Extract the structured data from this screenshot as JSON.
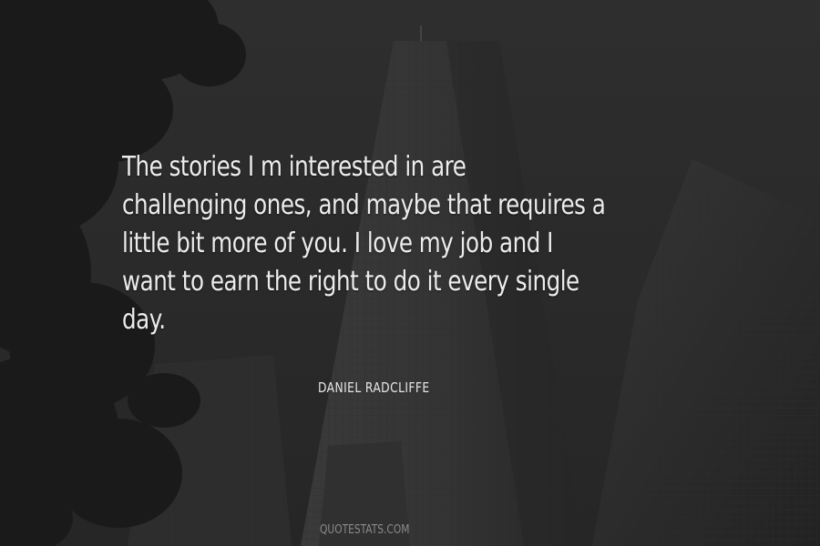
{
  "quote": {
    "lines": [
      "The stories I m interested in are",
      "challenging ones, and maybe that requires a",
      "little bit more of you. I love my job and I",
      "want to earn the right to do it every single",
      "day."
    ]
  },
  "author": "DANIEL RADCLIFFE",
  "watermark": "QUOTESTATS.COM",
  "colors": {
    "background": "#2b2b2b",
    "text": "#ececec",
    "watermark": "#8a8a8a"
  }
}
